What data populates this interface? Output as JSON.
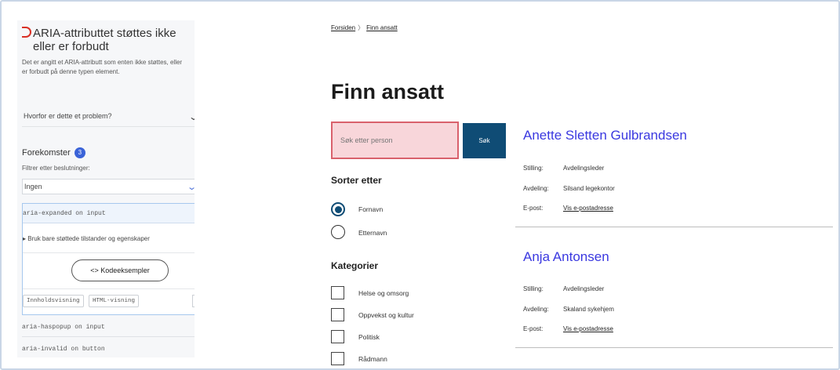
{
  "panel": {
    "issue_title_line1": "ARIA-attributtet støttes ikke",
    "issue_title_line2": "eller er forbudt",
    "issue_desc": "Det er angitt et ARIA-attributt som enten ikke støttes, eller er forbudt på denne typen element.",
    "why_select": "Hvorfor er dette et problem?",
    "occurrences_title": "Forekomster",
    "occurrences_count": "3",
    "filter_label": "Filtrer etter beslutninger:",
    "filter_value": "Ingen",
    "expanded_item": "aria-expanded on input",
    "guidance": "Bruk bare støttede tilstander og egenskaper",
    "code_examples_button": "<> Kodeeksempler",
    "content_view": "Innholdsvisning",
    "html_view": "HTML-visning",
    "collapsed_items": [
      "aria-haspopup on input",
      "aria-invalid on button"
    ]
  },
  "page": {
    "breadcrumb": [
      "Forsiden",
      "Finn ansatt"
    ],
    "title": "Finn ansatt",
    "search_placeholder": "Søk etter person",
    "search_button": "Søk",
    "sort_label": "Sorter etter",
    "sort_options": [
      {
        "label": "Fornavn",
        "checked": true
      },
      {
        "label": "Etternavn",
        "checked": false
      }
    ],
    "categories_label": "Kategorier",
    "categories": [
      "Helse og omsorg",
      "Oppvekst og kultur",
      "Politisk",
      "Rådmann"
    ]
  },
  "results": [
    {
      "name": "Anette Sletten Gulbrandsen",
      "position_key": "Stilling:",
      "position": "Avdelingsleder",
      "department_key": "Avdeling:",
      "department": "Silsand legekontor",
      "email_key": "E-post:",
      "email": "Vis e-postadresse"
    },
    {
      "name": "Anja Antonsen",
      "position_key": "Stilling:",
      "position": "Avdelingsleder",
      "department_key": "Avdeling:",
      "department": "Skaland sykehjem",
      "email_key": "E-post:",
      "email": "Vis e-postadresse"
    }
  ],
  "colors": {
    "error_red": "#d93025",
    "search_bg": "#f8d6da",
    "button_blue": "#0f4c75",
    "link_blue": "#3a38e0"
  }
}
